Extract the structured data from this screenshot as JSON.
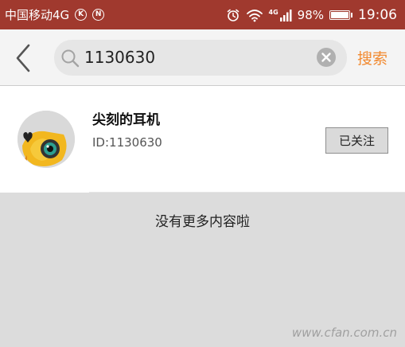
{
  "status_bar": {
    "carrier": "中国移动4G",
    "badge_1": "K",
    "badge_2": "N",
    "network": "4G",
    "battery": "98%",
    "battery_level": 0.98,
    "time": "19:06"
  },
  "search": {
    "value": "1130630",
    "placeholder": "",
    "button_label": "搜索"
  },
  "results": [
    {
      "name": "尖刻的耳机",
      "id_text": "ID:1130630",
      "follow_label": "已关注"
    }
  ],
  "footer": {
    "message": "没有更多内容啦"
  },
  "watermark": {
    "text": "www.cfan.com.cn"
  },
  "colors": {
    "status_bar_bg": "#a0392e",
    "accent": "#f28a30",
    "background": "#dcdcdc"
  },
  "icons": {
    "back": "chevron-left-icon",
    "search": "search-icon",
    "clear": "clear-icon",
    "alarm": "alarm-icon",
    "wifi": "wifi-icon",
    "signal": "signal-icon",
    "battery": "battery-icon"
  }
}
